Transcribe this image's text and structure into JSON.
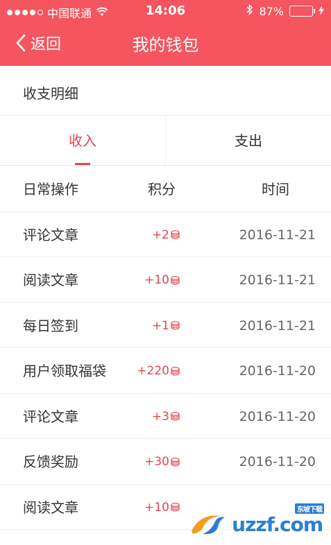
{
  "status_bar": {
    "carrier": "中国联通",
    "time": "14:06",
    "battery": "87%",
    "battery_level": 0.87,
    "signal_filled": 4,
    "signal_total": 5
  },
  "nav": {
    "back_label": "返回",
    "title": "我的钱包"
  },
  "section_title": "收支明细",
  "tabs": [
    {
      "label": "收入",
      "active": true
    },
    {
      "label": "支出",
      "active": false
    }
  ],
  "table": {
    "headers": [
      "日常操作",
      "积分",
      "时间"
    ],
    "rows": [
      {
        "action": "评论文章",
        "points": "+2",
        "date": "2016-11-21"
      },
      {
        "action": "阅读文章",
        "points": "+10",
        "date": "2016-11-21"
      },
      {
        "action": "每日签到",
        "points": "+1",
        "date": "2016-11-21"
      },
      {
        "action": "用户领取福袋",
        "points": "+220",
        "date": "2016-11-20"
      },
      {
        "action": "评论文章",
        "points": "+3",
        "date": "2016-11-20"
      },
      {
        "action": "反馈奖励",
        "points": "+30",
        "date": "2016-11-20"
      },
      {
        "action": "阅读文章",
        "points": "+10",
        "date": ""
      }
    ]
  },
  "watermark": {
    "text": "uzzf.com",
    "sub": "东坡下载"
  },
  "colors": {
    "header_bg": "#f4555f",
    "accent": "#e4454f",
    "battery_fill": "#4cd964"
  }
}
